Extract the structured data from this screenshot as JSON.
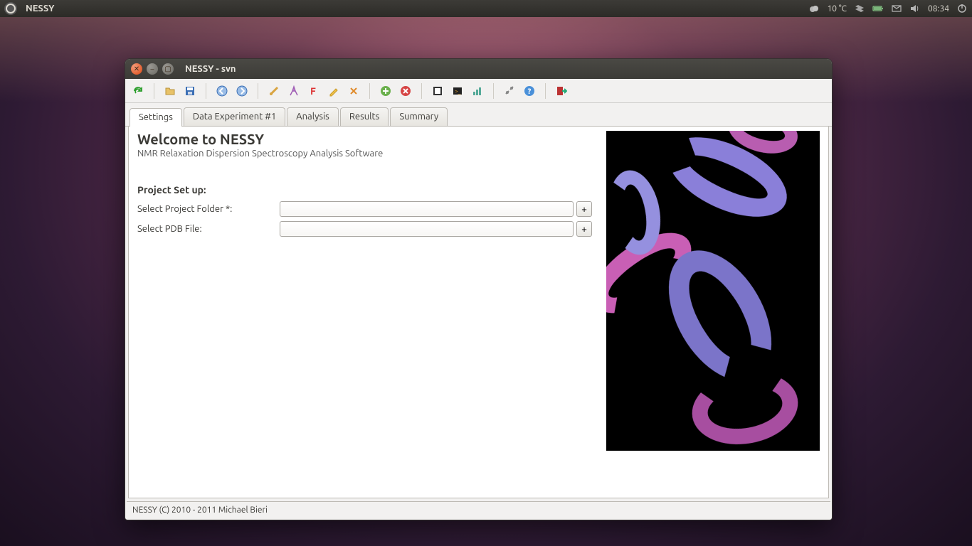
{
  "panel": {
    "app_name": "NESSY",
    "weather": "10 °C",
    "clock": "08:34"
  },
  "window": {
    "title": "NESSY - svn"
  },
  "tabs": {
    "settings": "Settings",
    "data_exp1": "Data Experiment #1",
    "analysis": "Analysis",
    "results": "Results",
    "summary": "Summary"
  },
  "settings": {
    "heading": "Welcome to NESSY",
    "subtitle": "NMR Relaxation Dispersion Spectroscopy Analysis Software",
    "section": "Project Set up:",
    "project_folder_label": "Select Project Folder *:",
    "project_folder_value": "",
    "pdb_label": "Select PDB File:",
    "pdb_value": "",
    "add_btn": "+"
  },
  "status": {
    "text": "NESSY (C) 2010 - 2011 Michael Bieri"
  }
}
